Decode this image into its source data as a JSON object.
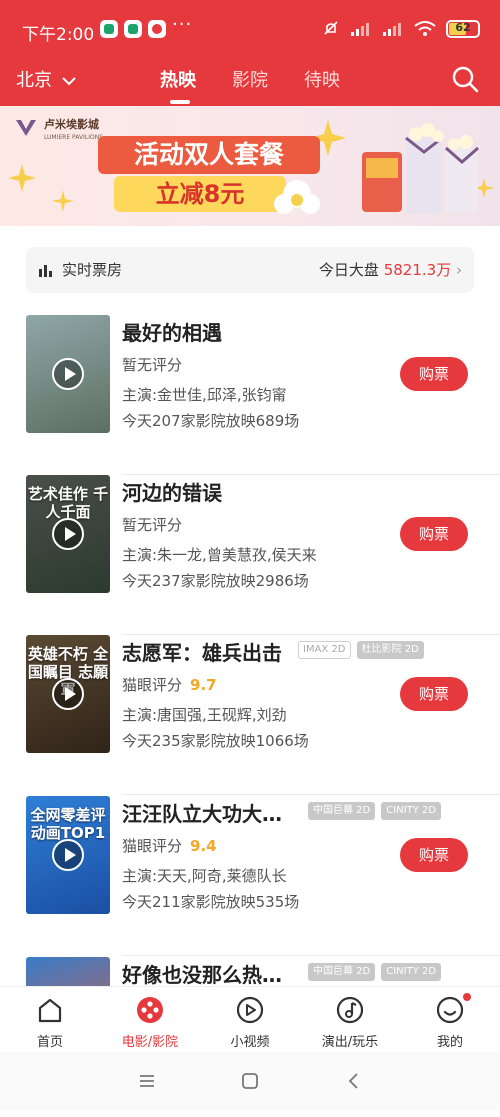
{
  "status_bar": {
    "time": "下午2:00",
    "more": "···",
    "battery": "62",
    "battery_level": 0.62
  },
  "nav": {
    "city": "北京",
    "tabs": [
      {
        "label": "热映"
      },
      {
        "label": "影院"
      },
      {
        "label": "待映"
      }
    ],
    "active_tab": "热映"
  },
  "banner": {
    "brand_name": "卢米埃影城",
    "brand_sub": "LUMIERE PAVILIONS",
    "headline": "活动双人套餐",
    "subline": "立减8元"
  },
  "box_office": {
    "label": "实时票房",
    "today_label": "今日大盘",
    "value": "5821.3万",
    "chevron": "›"
  },
  "movies": [
    {
      "title": "最好的相遇",
      "tags": [],
      "rating_label": "暂无评分",
      "score": "",
      "cast": "主演:金世佳,邱泽,张钧甯",
      "showings": "今天207家影院放映689场",
      "buy": "购票",
      "poster_text": "",
      "poster_colors": [
        "#8fa7a8",
        "#5d6f62"
      ]
    },
    {
      "title": "河边的错误",
      "tags": [],
      "rating_label": "暂无评分",
      "score": "",
      "cast": "主演:朱一龙,曾美慧孜,侯天来",
      "showings": "今天237家影院放映2986场",
      "buy": "购票",
      "poster_text": "艺术佳作 千人千面",
      "poster_colors": [
        "#4a4f4a",
        "#2c3a2e"
      ]
    },
    {
      "title": "志愿军：雄兵出击",
      "tags": [
        {
          "text": "IMAX 2D",
          "filled": false
        },
        {
          "text": "杜比影院 2D",
          "filled": true
        }
      ],
      "rating_label": "猫眼评分",
      "score": "9.7",
      "cast": "主演:唐国强,王砚辉,刘劲",
      "showings": "今天235家影院放映1066场",
      "buy": "购票",
      "poster_text": "英雄不朽 全国瞩目 志願軍",
      "poster_colors": [
        "#5b4a34",
        "#2f2418"
      ]
    },
    {
      "title": "汪汪队立大功大…",
      "tags": [
        {
          "text": "中国巨幕 2D",
          "filled": true
        },
        {
          "text": "CINITY 2D",
          "filled": true
        }
      ],
      "rating_label": "猫眼评分",
      "score": "9.4",
      "cast": "主演:天天,阿奇,莱德队长",
      "showings": "今天211家影院放映535场",
      "buy": "购票",
      "poster_text": "全网零差评 动画TOP1",
      "poster_colors": [
        "#2f7fd6",
        "#1b4fa3"
      ]
    },
    {
      "title": "好像也没那么热…",
      "tags": [
        {
          "text": "中国巨幕 2D",
          "filled": true
        },
        {
          "text": "CINITY 2D",
          "filled": true
        }
      ],
      "rating_label": "",
      "score": "",
      "cast": "",
      "showings": "",
      "buy": "",
      "poster_text": "",
      "poster_colors": [
        "#3a7cc8",
        "#e25a3a"
      ]
    }
  ],
  "bottom_nav": [
    {
      "label": "首页",
      "icon": "home-icon"
    },
    {
      "label": "电影/影院",
      "icon": "film-reel-icon"
    },
    {
      "label": "小视频",
      "icon": "play-circle-icon"
    },
    {
      "label": "演出/玩乐",
      "icon": "music-note-icon"
    },
    {
      "label": "我的",
      "icon": "profile-icon"
    }
  ],
  "colors": {
    "brand": "#e5393d",
    "score": "#f5a623"
  }
}
